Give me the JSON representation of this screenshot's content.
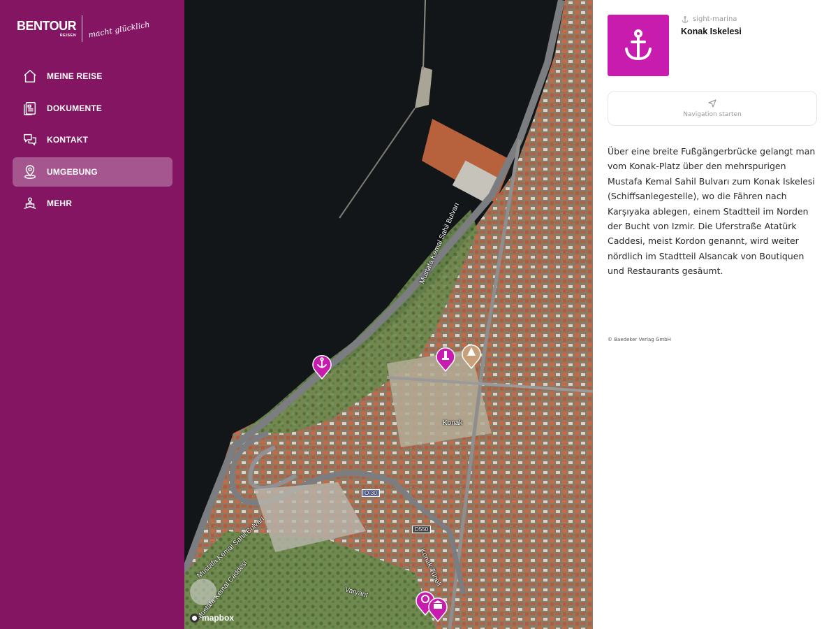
{
  "brand": {
    "name": "BENTOUR",
    "sub": "REISEN",
    "tagline": "macht glücklich"
  },
  "sidebar": {
    "items": [
      {
        "label": "MEINE REISE",
        "icon": "home-icon"
      },
      {
        "label": "DOKUMENTE",
        "icon": "documents-icon"
      },
      {
        "label": "KONTAKT",
        "icon": "chat-icon"
      },
      {
        "label": "UMGEBUNG",
        "icon": "location-pin-icon",
        "active": true
      },
      {
        "label": "MEHR",
        "icon": "more-icon"
      }
    ]
  },
  "map": {
    "street_labels": [
      "Mustafa Kemal Sahil Bulvarı",
      "Mustafa Kemal Sahil Bulvarı",
      "Mustafa Kemal Caddesi",
      "Varyant",
      "Konak Tüneli",
      "Konak"
    ],
    "road_shields": [
      "O-30",
      "D550"
    ],
    "attribution": "mapbox",
    "pins": [
      {
        "icon": "anchor-icon",
        "color": "#c81cae",
        "selected": true
      },
      {
        "icon": "monument-icon",
        "color": "#c81cae"
      },
      {
        "icon": "landmark-icon",
        "color": "#c8a07a"
      },
      {
        "icon": "sight-icon",
        "color": "#c81cae"
      },
      {
        "icon": "museum-icon",
        "color": "#c81cae"
      }
    ]
  },
  "panel": {
    "category": "sight-marina",
    "title": "Konak Iskelesi",
    "navigation_label": "Navigation starten",
    "description": "Über eine breite Fußgängerbrücke gelangt man vom Konak-Platz über den mehrspurigen Mustafa Kemal Sahil Bulvarı zum Konak Iskelesi (Schiffsanlegestelle), wo die Fähren nach Karşıyaka ablegen, einem Stadtteil im Norden der Bucht von Izmir. Die Uferstraße Atatürk Caddesi, meist Kordon genannt, wird weiter nördlich im Stadtteil Alsancak von Boutiquen und Restaurants gesäumt.",
    "copyright": "© Baedeker Verlag GmbH"
  },
  "colors": {
    "sidebar": "#831563",
    "accent": "#c81cae"
  }
}
